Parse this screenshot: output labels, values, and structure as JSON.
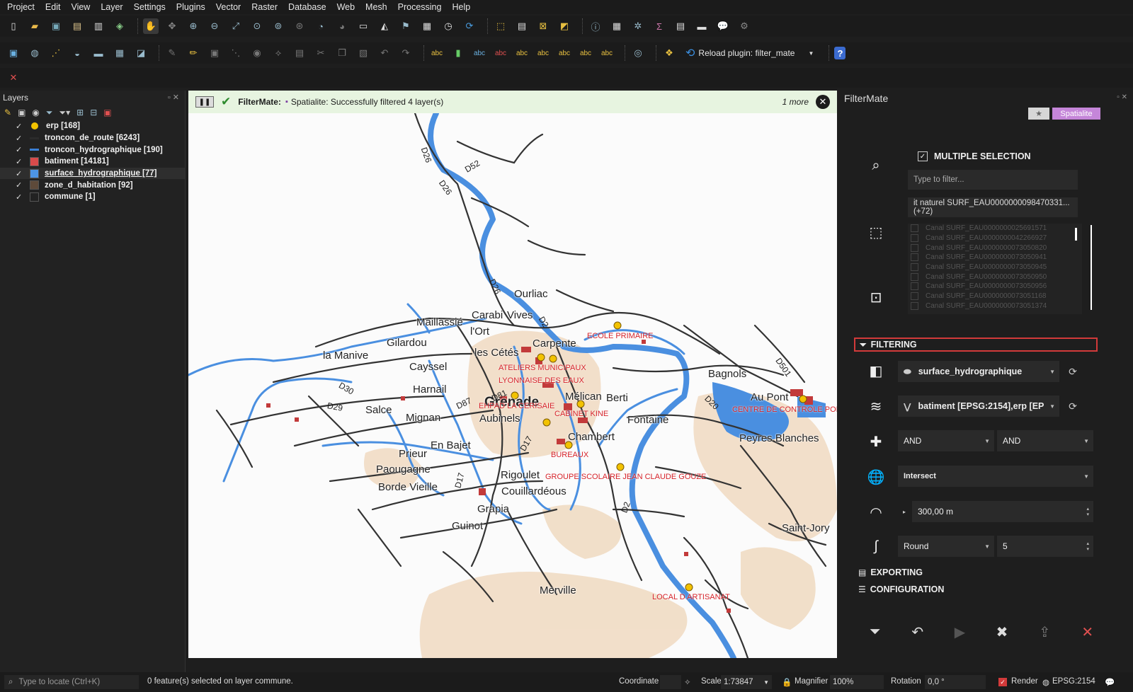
{
  "menu": [
    "Project",
    "Edit",
    "View",
    "Layer",
    "Settings",
    "Plugins",
    "Vector",
    "Raster",
    "Database",
    "Web",
    "Mesh",
    "Processing",
    "Help"
  ],
  "toolbar": {
    "row1_icons": [
      "new-project-icon",
      "open-project-icon",
      "save-project-icon",
      "print-layout-icon",
      "layout-manager-icon",
      "style-manager-icon",
      "pan-icon",
      "pan-to-selection-icon",
      "zoom-in-icon",
      "zoom-out-icon",
      "zoom-full-icon",
      "zoom-selection-icon",
      "zoom-layer-icon",
      "zoom-native-icon",
      "zoom-last-icon",
      "zoom-next-icon",
      "new-map-view-icon",
      "new-3d-view-icon",
      "new-bookmark-icon",
      "show-bookmarks-icon",
      "temporal-icon",
      "refresh-icon",
      "select-icon",
      "select-attribute-icon",
      "deselect-icon",
      "select-location-icon",
      "identify-icon",
      "attribute-table-icon",
      "field-calc-icon",
      "statistics-icon",
      "open-table-icon",
      "measure-icon",
      "map-tips-icon",
      "annotation-icon"
    ],
    "row2_icons": [
      "data-source-manager-icon",
      "new-geopackage-icon",
      "new-shapefile-icon",
      "new-scratch-icon",
      "new-virtual-icon",
      "grid-icon",
      "vector-edit-icon",
      "edit-pencil-icon",
      "save-edits-icon",
      "digitize-icon",
      "add-feature-icon",
      "vertex-tool-icon",
      "modify-icon",
      "delete-icon",
      "cut-icon",
      "copy-icon",
      "paste-icon",
      "undo-icon",
      "redo-icon",
      "label-icon",
      "layer-diagram-icon",
      "pin-label-icon",
      "highlight-label-icon",
      "show-label-icon",
      "move-label-icon",
      "rotate-label-icon",
      "label-props-icon",
      "toggle-label-icon",
      "python-console-icon",
      "python-icon"
    ],
    "reload_label": "Reload plugin: filter_mate",
    "help_icon": "help-icon",
    "row3_icons": [
      "filtermate-icon"
    ]
  },
  "layers_panel": {
    "title": "Layers",
    "tools": [
      "open-layer-styling-icon",
      "add-group-icon",
      "manage-visibility-icon",
      "filter-legend-icon",
      "filter-expression-icon",
      "expand-all-icon",
      "collapse-all-icon",
      "remove-layer-icon"
    ],
    "items": [
      {
        "name": "erp [168]",
        "symbol": "point",
        "color": "#f2c200"
      },
      {
        "name": "troncon_de_route [6243]",
        "symbol": "line",
        "color": "#2b2b2b"
      },
      {
        "name": "troncon_hydrographique [190]",
        "symbol": "line",
        "color": "#3a7fd5"
      },
      {
        "name": "batiment [14181]",
        "symbol": "fill",
        "color": "#d84b4b"
      },
      {
        "name": "surface_hydrographique [77]",
        "symbol": "fill",
        "color": "#4d95e6"
      },
      {
        "name": "zone_d_habitation [92]",
        "symbol": "fill",
        "color": "#5e4a3a"
      },
      {
        "name": "commune [1]",
        "symbol": "fill",
        "color": "#222222"
      }
    ]
  },
  "message": {
    "title": "FilterMate:",
    "text": "Spatialite: Successfully filtered 4 layer(s)",
    "more": "1 more"
  },
  "map": {
    "places": [
      {
        "name": "Ourliac"
      },
      {
        "name": "Carabi"
      },
      {
        "name": "Vives"
      },
      {
        "name": "Maillassié"
      },
      {
        "name": "l'Ort"
      },
      {
        "name": "Gilardou"
      },
      {
        "name": "Carpente"
      },
      {
        "name": "la Manive"
      },
      {
        "name": "les Cétés"
      },
      {
        "name": "Cayssel"
      },
      {
        "name": "Harnail"
      },
      {
        "name": "Mélican"
      },
      {
        "name": "Berti"
      },
      {
        "name": "Bagnols"
      },
      {
        "name": "Au Pont"
      },
      {
        "name": "Salce"
      },
      {
        "name": "Mignan"
      },
      {
        "name": "Aubinels"
      },
      {
        "name": "Fontaine"
      },
      {
        "name": "Chambert"
      },
      {
        "name": "Peyres Blanches"
      },
      {
        "name": "Prieur"
      },
      {
        "name": "En Bajet"
      },
      {
        "name": "Paougagne"
      },
      {
        "name": "Rigoulet"
      },
      {
        "name": "Borde Vieille"
      },
      {
        "name": "Couillardéous"
      },
      {
        "name": "Grapia"
      },
      {
        "name": "Guinot"
      },
      {
        "name": "Saint-Jory"
      },
      {
        "name": "Merville"
      },
      {
        "name": "Grenade"
      }
    ],
    "roads": [
      {
        "name": "D26"
      },
      {
        "name": "D52"
      },
      {
        "name": "D26"
      },
      {
        "name": "D26"
      },
      {
        "name": "D2"
      },
      {
        "name": "D30"
      },
      {
        "name": "D29"
      },
      {
        "name": "D87"
      },
      {
        "name": "D81"
      },
      {
        "name": "D17"
      },
      {
        "name": "D17"
      },
      {
        "name": "D501"
      },
      {
        "name": "D20"
      },
      {
        "name": "D2"
      }
    ],
    "pois": [
      {
        "name": "ECOLE PRIMAIRE"
      },
      {
        "name": "ATELIERS MUNICIPAUX"
      },
      {
        "name": "LYONNAISE DES EAUX"
      },
      {
        "name": "EHPAD LA CERISAIE"
      },
      {
        "name": "CABINET KINE"
      },
      {
        "name": "CENTRE DE CONTROLE POID"
      },
      {
        "name": "BUREAUX"
      },
      {
        "name": "GROUPE SCOLAIRE JEAN CLAUDE GOUZE"
      },
      {
        "name": "LOCAL D ARTISANAT"
      }
    ]
  },
  "filtermate": {
    "title": "FilterMate",
    "star": "★",
    "backend_badge": "Spatialite",
    "multiple_selection_label": "MULTIPLE SELECTION",
    "filter_placeholder": "Type to filter...",
    "selected_summary": "it naturel SURF_EAU0000000098470331... (+72)",
    "list_items": [
      "Canal SURF_EAU0000000025691571",
      "Canal SURF_EAU0000000042266927",
      "Canal SURF_EAU0000000073050820",
      "Canal SURF_EAU0000000073050941",
      "Canal SURF_EAU0000000073050945",
      "Canal SURF_EAU0000000073050950",
      "Canal SURF_EAU0000000073050956",
      "Canal SURF_EAU0000000073051168",
      "Canal SURF_EAU0000000073051374"
    ],
    "filtering_label": "FILTERING",
    "source_layer": "surface_hydrographique",
    "target_layers": "batiment [EPSG:2154],erp [EP",
    "combine_op_1": "AND",
    "combine_op_2": "AND",
    "predicate": "Intersect",
    "buffer": "300,00 m",
    "buffer_type": "Round",
    "segments": "5",
    "exporting_label": "EXPORTING",
    "configuration_label": "CONFIGURATION"
  },
  "statusbar": {
    "locate_placeholder": "Type to locate (Ctrl+K)",
    "selection_info": "0 feature(s) selected on layer commune.",
    "coordinate_label": "Coordinate",
    "scale_label": "Scale",
    "scale_value": "1:73847",
    "magnifier_label": "Magnifier",
    "magnifier_value": "100%",
    "rotation_label": "Rotation",
    "rotation_value": "0,0 °",
    "render_label": "Render",
    "crs": "EPSG:2154"
  }
}
